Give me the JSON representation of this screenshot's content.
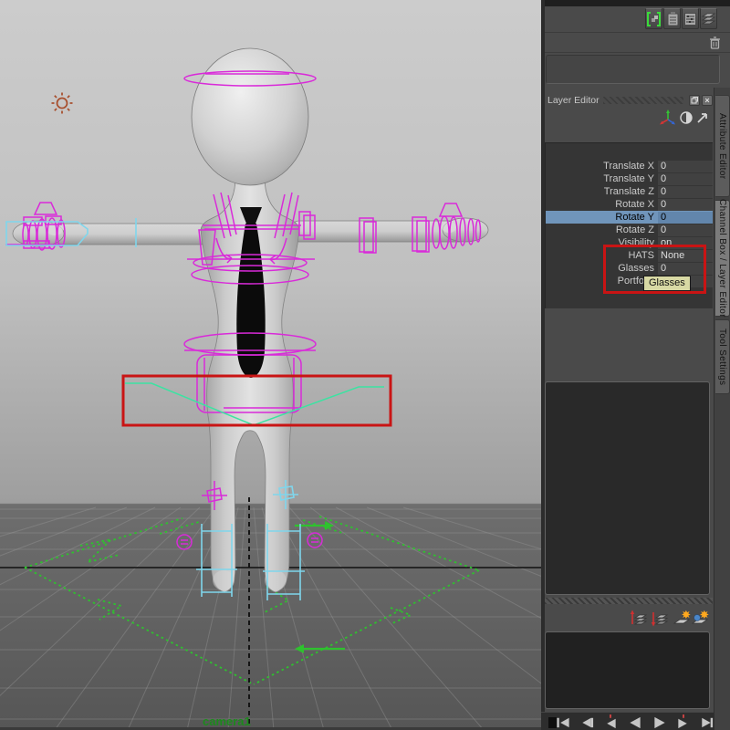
{
  "window": {
    "camera_label": "camera1"
  },
  "panel": {
    "layer_editor_title": "Layer Editor",
    "channel_box": {
      "rows": [
        {
          "label": "Translate X",
          "value": "0",
          "highlighted": false
        },
        {
          "label": "Translate Y",
          "value": "0",
          "highlighted": false
        },
        {
          "label": "Translate Z",
          "value": "0",
          "highlighted": false
        },
        {
          "label": "Rotate X",
          "value": "0",
          "highlighted": false
        },
        {
          "label": "Rotate Y",
          "value": "0",
          "highlighted": true
        },
        {
          "label": "Rotate Z",
          "value": "0",
          "highlighted": false
        },
        {
          "label": "Visibility",
          "value": "on",
          "highlighted": false
        },
        {
          "label": "HATS",
          "value": "None",
          "highlighted": false
        },
        {
          "label": "Glasses",
          "value": "0",
          "highlighted": false
        },
        {
          "label": "Portfolio",
          "value": "",
          "highlighted": false
        }
      ]
    },
    "tooltip": "Glasses",
    "tabs": [
      {
        "label": "Attribute Editor",
        "active": false
      },
      {
        "label": "Channel Box / Layer Editor",
        "active": true
      },
      {
        "label": "Tool Settings",
        "active": false
      }
    ],
    "close_glyph": "×"
  },
  "toolbars": {
    "top_icons": [
      "selection-highlight",
      "clipboard",
      "channel-sliders",
      "layers-stack"
    ],
    "mini_icons": [
      "move-axis",
      "contrast-sphere",
      "arrow-ne"
    ],
    "layer_icons": [
      "move-layer-up",
      "move-layer-down",
      "new-empty-layer",
      "new-layer-from-selected"
    ],
    "playback_icons": [
      "go-to-start",
      "step-back-frame",
      "step-back-key",
      "play-backward",
      "play-forward",
      "step-forward-key",
      "step-forward-frame",
      "go-to-end"
    ]
  },
  "colors": {
    "highlight_row": "#7095bb",
    "annotation_red": "#c91414",
    "magenta_rig": "#d92ad9",
    "cyan_selection": "#7fd6ec",
    "green_guides": "#2ec22e",
    "mint_hip_curve": "#3ce3a2",
    "tooltip_bg": "#d8d9a4",
    "camera_label_green": "#1c8a1c"
  }
}
